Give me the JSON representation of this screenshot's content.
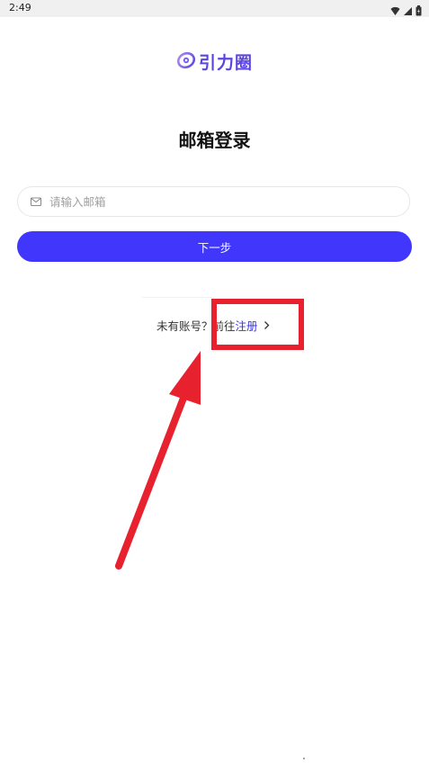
{
  "status_bar": {
    "time": "2:49",
    "icons": [
      "wifi-icon",
      "cellular-signal-icon",
      "battery-icon"
    ]
  },
  "app": {
    "logo_text": "引力圈",
    "brand_color": "#5a45e0"
  },
  "page": {
    "title": "邮箱登录"
  },
  "email_field": {
    "icon": "mail-icon",
    "value": "",
    "placeholder": "请输入邮箱"
  },
  "next_button": {
    "label": "下一步",
    "color": "#4136fb"
  },
  "register": {
    "prompt": "未有账号？前往",
    "link": "注册",
    "icon": "chevron-right-icon",
    "link_color": "#3a34e0"
  },
  "annotation": {
    "highlight_color": "#e8212e",
    "icon": "arrow-icon"
  }
}
